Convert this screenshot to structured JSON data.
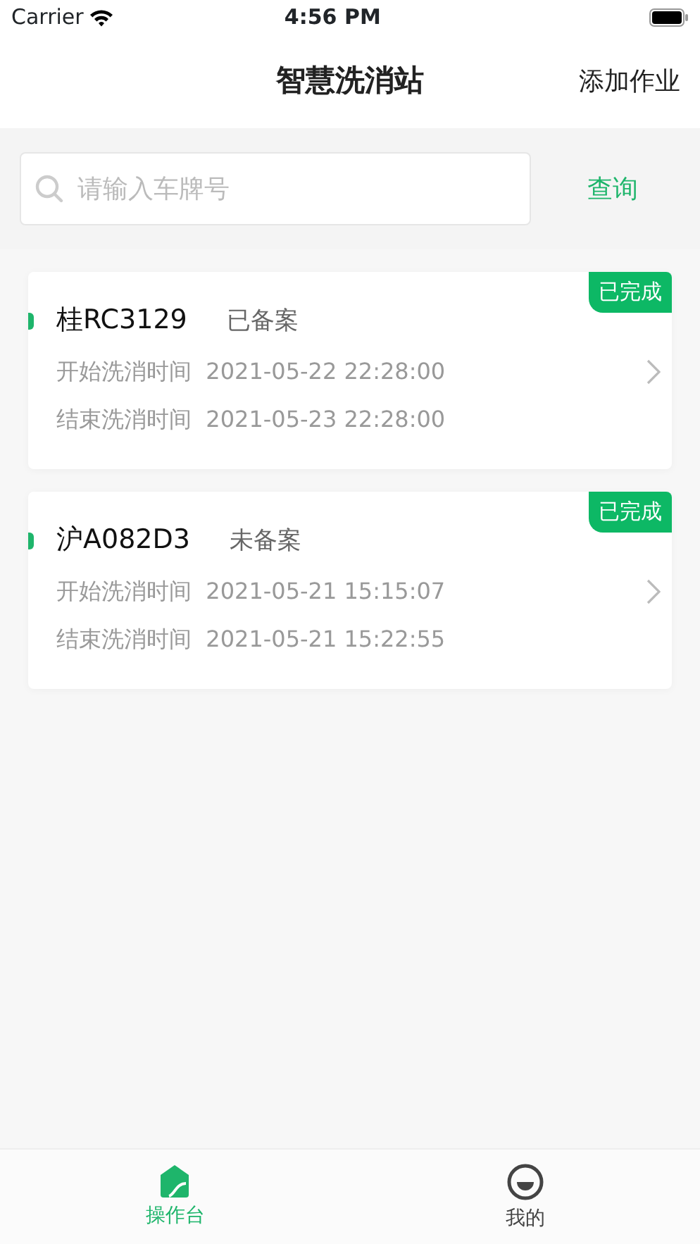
{
  "status_bar": {
    "carrier": "Carrier",
    "time": "4:56 PM"
  },
  "nav": {
    "title": "智慧洗消站",
    "action": "添加作业"
  },
  "search": {
    "placeholder": "请输入车牌号",
    "button": "查询"
  },
  "records": [
    {
      "plate": "桂RC3129",
      "filing": "已备案",
      "badge": "已完成",
      "start_label": "开始洗消时间",
      "start_time": "2021-05-22 22:28:00",
      "end_label": "结束洗消时间",
      "end_time": "2021-05-23 22:28:00"
    },
    {
      "plate": "沪A082D3",
      "filing": "未备案",
      "badge": "已完成",
      "start_label": "开始洗消时间",
      "start_time": "2021-05-21 15:15:07",
      "end_label": "结束洗消时间",
      "end_time": "2021-05-21 15:22:55"
    }
  ],
  "tabs": [
    {
      "label": "操作台",
      "kind": "home",
      "selected": true
    },
    {
      "label": "我的",
      "kind": "profile",
      "selected": false
    }
  ]
}
